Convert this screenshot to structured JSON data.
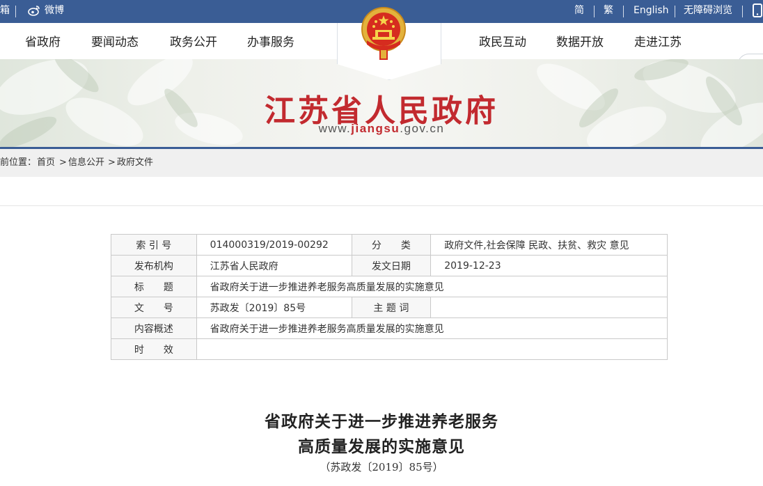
{
  "topbar": {
    "mailbox_fragment": "箱",
    "weibo": "微博",
    "simplified": "简",
    "traditional": "繁",
    "english": "English",
    "accessible": "无障碍浏览",
    "bg_color": "#3a5d95"
  },
  "nav": {
    "items_left": [
      "省政府",
      "要闻动态",
      "政务公开",
      "办事服务"
    ],
    "items_right": [
      "政民互动",
      "数据开放",
      "走进江苏"
    ]
  },
  "banner": {
    "title": "江苏省人民政府",
    "url_prefix": "www.",
    "url_domain": "jiangsu",
    "url_suffix": ".gov.cn",
    "title_color": "#c22a2f"
  },
  "breadcrumb": {
    "label": "前位置：",
    "home": "首页",
    "sep": ">",
    "level1": "信息公开",
    "level2": "政府文件"
  },
  "meta": {
    "index_label": "索 引 号",
    "index_value": "014000319/2019-00292",
    "category_label": "分　　类",
    "category_value": "政府文件,社会保障 民政、扶贫、救灾 意见",
    "publisher_label": "发布机构",
    "publisher_value": "江苏省人民政府",
    "date_label": "发文日期",
    "date_value": "2019-12-23",
    "title_label": "标　　题",
    "title_value": "省政府关于进一步推进养老服务高质量发展的实施意见",
    "docno_label": "文　　号",
    "docno_value": "苏政发〔2019〕85号",
    "keywords_label": "主 题 词",
    "keywords_value": "",
    "summary_label": "内容概述",
    "summary_value": "省政府关于进一步推进养老服务高质量发展的实施意见",
    "validity_label": "时　　效",
    "validity_value": ""
  },
  "article": {
    "title_line1": "省政府关于进一步推进养老服务",
    "title_line2": "高质量发展的实施意见",
    "doc_number": "（苏政发〔2019〕85号）"
  }
}
